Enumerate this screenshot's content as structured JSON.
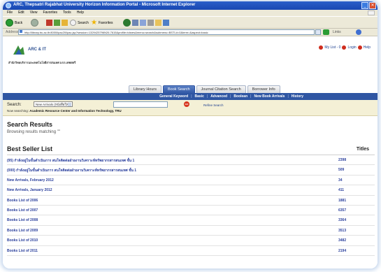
{
  "window": {
    "title": "ARC, Thepsatri Rajabhat University Horizon Information Portal - Microsoft Internet Explorer"
  },
  "menubar": [
    "File",
    "Edit",
    "View",
    "Favorites",
    "Tools",
    "Help"
  ],
  "toolbar": {
    "back_label": "Back",
    "search_label": "Search",
    "favorites_label": "Favorites"
  },
  "addressbar": {
    "label": "Address",
    "url": "http://library.tru.ac.th:8000/ipac20/ipac.jsp?session=1329425796N26.7615&profile=tdsres&menu=search&submenu=BSTL#=0&term=&aspect=basic",
    "links_label": "Links"
  },
  "header": {
    "logo_text": "ARC & IT",
    "logo_subtitle": "สำนักวิทยบริการและเทคโนโลยีสารสนเทศ มรภ.เทพสตรี"
  },
  "userlinks": {
    "mylist": "My List - 0",
    "login": "Login",
    "help": "Help"
  },
  "tabs": [
    {
      "label": "Library Hours",
      "active": false
    },
    {
      "label": "Book Search",
      "active": true
    },
    {
      "label": "Journal Citation Search",
      "active": false
    },
    {
      "label": "Borrower Info",
      "active": false
    }
  ],
  "subnav": [
    "General Keyword",
    "Basic",
    "Advanced",
    "Boolean",
    "New Book Arrivals",
    "History"
  ],
  "search": {
    "label": "Search:",
    "select_value": "New Arrivals (หนังสือใหม่)",
    "input_value": "",
    "go_label": "GO",
    "refine_label": "Refine Search",
    "now_searching_label": "Now searching:",
    "now_searching_value": "Academic Resource Center and Information Technology, TRU"
  },
  "results": {
    "title": "Search Results",
    "subtitle": "Browsing results matching \"\""
  },
  "list": {
    "heading": "Best Seller List",
    "count_heading": "Titles",
    "rows": [
      {
        "name": "(95) กำลังอยู่ในขั้นดำเนินการ สนใจติดต่อฝ่ายงานวิเคราะห์ทรัพยากรสารสนเทศ ชั้น 1",
        "count": "2398"
      },
      {
        "name": "(000) กำลังอยู่ในขั้นดำเนินการ สนใจติดต่อฝ่ายงานวิเคราะห์ทรัพยากรสารสนเทศ ชั้น 1",
        "count": "509"
      },
      {
        "name": "New Arrivals, February 2012",
        "count": "34"
      },
      {
        "name": "New Arrivals, January 2012",
        "count": "411"
      },
      {
        "name": "Books List of 2006",
        "count": "1881"
      },
      {
        "name": "Books List of 2007",
        "count": "6357"
      },
      {
        "name": "Books List of 2008",
        "count": "3364"
      },
      {
        "name": "Books List of 2009",
        "count": "3513"
      },
      {
        "name": "Books List of 2010",
        "count": "3482"
      },
      {
        "name": "Books List of 2011",
        "count": "2194"
      }
    ]
  },
  "colors": {
    "ie_titlebar": "#1948b2",
    "nav_blue": "#2f56a3",
    "search_bg": "#f4f0d6",
    "link": "#2a3f9c"
  }
}
